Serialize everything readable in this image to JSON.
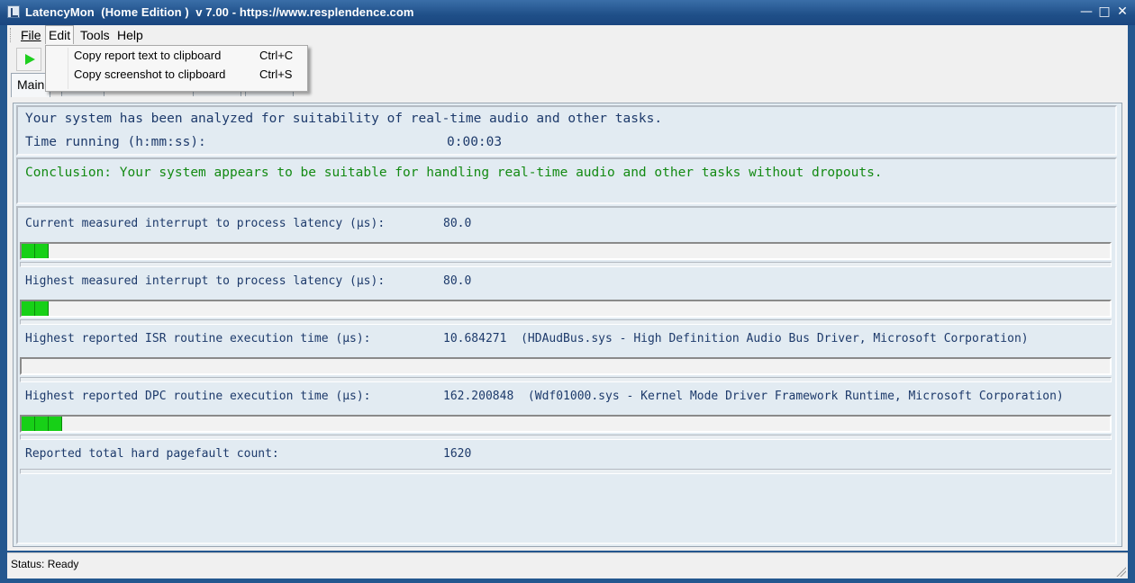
{
  "window": {
    "title": "LatencyMon  (Home Edition )  v 7.00 - https://www.resplendence.com",
    "controls": [
      "minimize-icon",
      "maximize-icon",
      "close-icon"
    ]
  },
  "menu": {
    "file": "File",
    "edit": "Edit",
    "tools": "Tools",
    "help": "Help"
  },
  "edit_menu": {
    "items": [
      {
        "label": "Copy report text to clipboard",
        "shortcut": "Ctrl+C"
      },
      {
        "label": "Copy screenshot to clipboard",
        "shortcut": "Ctrl+S"
      }
    ]
  },
  "toolbar": {
    "play_icon": "play-icon",
    "play_color": "#1fcf1f"
  },
  "tabs": {
    "main": "Main"
  },
  "summary": {
    "analyzed": "Your system has been analyzed for suitability of real-time audio and other tasks.",
    "time_label": "Time running (h:mm:ss):",
    "time_value": "0:00:03"
  },
  "conclusion": {
    "text": "Conclusion: Your system appears to be suitable for handling real-time audio and other tasks without dropouts.",
    "color": "#138a13"
  },
  "metrics": [
    {
      "label": "Current measured interrupt to process latency (µs):",
      "value": "80.0",
      "segments": 2
    },
    {
      "label": "Highest measured interrupt to process latency (µs):",
      "value": "80.0",
      "segments": 2
    },
    {
      "label": "Highest reported ISR routine execution time (µs):",
      "value": "10.684271  (HDAudBus.sys - High Definition Audio Bus Driver, Microsoft Corporation)",
      "segments": 0
    },
    {
      "label": "Highest reported DPC routine execution time (µs):",
      "value": "162.200848  (Wdf01000.sys - Kernel Mode Driver Framework Runtime, Microsoft Corporation)",
      "segments": 3
    },
    {
      "label": "Reported total hard pagefault count:",
      "value": "1620"
    }
  ],
  "status": {
    "text": "Status: Ready"
  },
  "colors": {
    "bar_fill": "#17d017",
    "title_bar": "#1f4f88",
    "text": "#1d3a6b"
  }
}
